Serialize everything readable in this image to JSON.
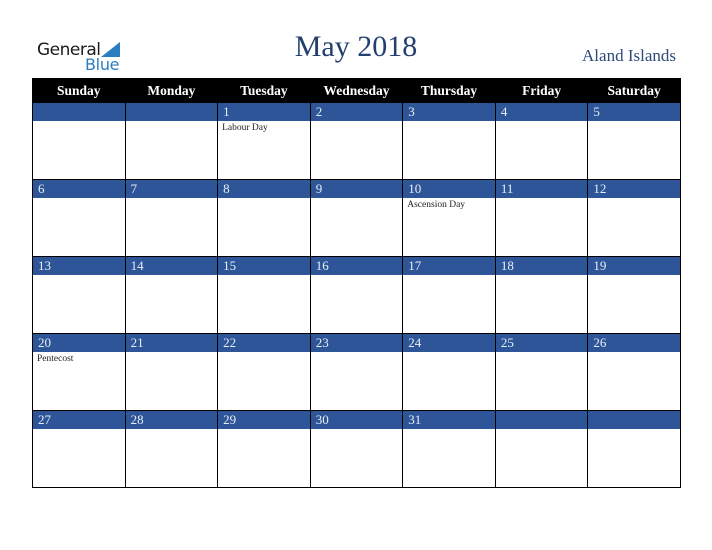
{
  "header": {
    "logo": {
      "word1": "General",
      "word2": "Blue"
    },
    "title": "May 2018",
    "country": "Aland Islands"
  },
  "colors": {
    "title": "#233f6e",
    "day_bar": "#2e5597",
    "header_bg": "#000000",
    "logo_blue": "#2a7ec1"
  },
  "weekdays": [
    "Sunday",
    "Monday",
    "Tuesday",
    "Wednesday",
    "Thursday",
    "Friday",
    "Saturday"
  ],
  "weeks": [
    [
      {
        "day": "",
        "event": ""
      },
      {
        "day": "",
        "event": ""
      },
      {
        "day": "1",
        "event": "Labour Day"
      },
      {
        "day": "2",
        "event": ""
      },
      {
        "day": "3",
        "event": ""
      },
      {
        "day": "4",
        "event": ""
      },
      {
        "day": "5",
        "event": ""
      }
    ],
    [
      {
        "day": "6",
        "event": ""
      },
      {
        "day": "7",
        "event": ""
      },
      {
        "day": "8",
        "event": ""
      },
      {
        "day": "9",
        "event": ""
      },
      {
        "day": "10",
        "event": "Ascension Day"
      },
      {
        "day": "11",
        "event": ""
      },
      {
        "day": "12",
        "event": ""
      }
    ],
    [
      {
        "day": "13",
        "event": ""
      },
      {
        "day": "14",
        "event": ""
      },
      {
        "day": "15",
        "event": ""
      },
      {
        "day": "16",
        "event": ""
      },
      {
        "day": "17",
        "event": ""
      },
      {
        "day": "18",
        "event": ""
      },
      {
        "day": "19",
        "event": ""
      }
    ],
    [
      {
        "day": "20",
        "event": "Pentecost"
      },
      {
        "day": "21",
        "event": ""
      },
      {
        "day": "22",
        "event": ""
      },
      {
        "day": "23",
        "event": ""
      },
      {
        "day": "24",
        "event": ""
      },
      {
        "day": "25",
        "event": ""
      },
      {
        "day": "26",
        "event": ""
      }
    ],
    [
      {
        "day": "27",
        "event": ""
      },
      {
        "day": "28",
        "event": ""
      },
      {
        "day": "29",
        "event": ""
      },
      {
        "day": "30",
        "event": ""
      },
      {
        "day": "31",
        "event": ""
      },
      {
        "day": "",
        "event": ""
      },
      {
        "day": "",
        "event": ""
      }
    ]
  ]
}
